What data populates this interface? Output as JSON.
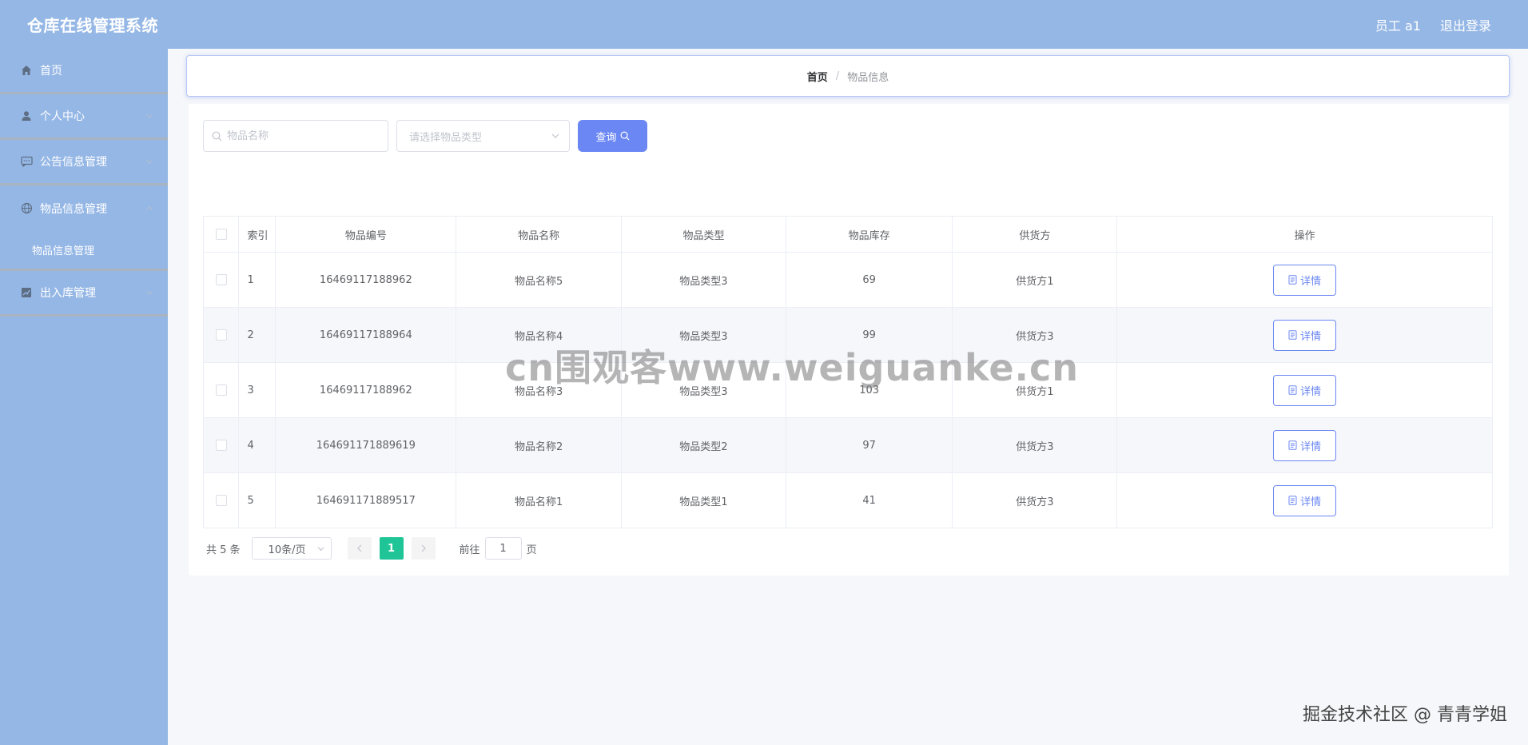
{
  "app": {
    "title": "仓库在线管理系统"
  },
  "header": {
    "user_label": "员工 a1",
    "logout_label": "退出登录"
  },
  "sidebar": {
    "items": [
      {
        "label": "首页",
        "icon": "home-icon"
      },
      {
        "label": "个人中心",
        "icon": "user-icon"
      },
      {
        "label": "公告信息管理",
        "icon": "message-icon"
      },
      {
        "label": "物品信息管理",
        "icon": "globe-icon"
      },
      {
        "label": "出入库管理",
        "icon": "chart-icon"
      }
    ],
    "submenu": {
      "label": "物品信息管理"
    }
  },
  "breadcrumb": {
    "home": "首页",
    "separator": "/",
    "current": "物品信息"
  },
  "search": {
    "name_placeholder": "物品名称",
    "type_placeholder": "请选择物品类型",
    "button_label": "查询"
  },
  "table": {
    "headers": [
      "索引",
      "物品编号",
      "物品名称",
      "物品类型",
      "物品库存",
      "供货方",
      "操作"
    ],
    "rows": [
      {
        "index": "1",
        "code": "16469117188962",
        "name": "物品名称5",
        "type": "物品类型3",
        "stock": "69",
        "supplier": "供货方1"
      },
      {
        "index": "2",
        "code": "16469117188964",
        "name": "物品名称4",
        "type": "物品类型3",
        "stock": "99",
        "supplier": "供货方3"
      },
      {
        "index": "3",
        "code": "16469117188962",
        "name": "物品名称3",
        "type": "物品类型3",
        "stock": "103",
        "supplier": "供货方1"
      },
      {
        "index": "4",
        "code": "164691171889619",
        "name": "物品名称2",
        "type": "物品类型2",
        "stock": "97",
        "supplier": "供货方3"
      },
      {
        "index": "5",
        "code": "164691171889517",
        "name": "物品名称1",
        "type": "物品类型1",
        "stock": "41",
        "supplier": "供货方3"
      }
    ],
    "detail_label": "详情"
  },
  "pagination": {
    "total": "共 5 条",
    "page_size": "10条/页",
    "current_page": "1",
    "goto_prefix": "前往",
    "goto_value": "1",
    "goto_suffix": "页"
  },
  "overlay": {
    "watermark": "cn围观客www.weiguanke.cn",
    "attribution": "掘金技术社区 @ 青青学姐"
  },
  "colors": {
    "header_bg": "#95b7e5",
    "primary": "#6b87f4",
    "page_active": "#1fc596"
  }
}
